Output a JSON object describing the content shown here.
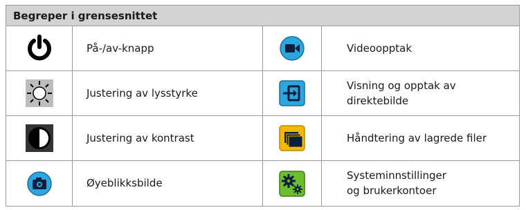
{
  "table": {
    "title": "Begreper i grensesnittet",
    "left": [
      {
        "icon": "power-icon",
        "label": "På-/av-knapp"
      },
      {
        "icon": "brightness-icon",
        "label": "Justering av lysstyrke"
      },
      {
        "icon": "contrast-icon",
        "label": "Justering av kontrast"
      },
      {
        "icon": "camera-icon",
        "label": "Øyeblikksbilde"
      }
    ],
    "right": [
      {
        "icon": "video-camera-icon",
        "label": "Videoopptak"
      },
      {
        "icon": "live-view-icon",
        "label_line1": "Visning og opptak av",
        "label_line2": "direktebilde"
      },
      {
        "icon": "folders-icon",
        "label": "Håndtering av lagrede filer"
      },
      {
        "icon": "gears-icon",
        "label_line1": "Systeminnstillinger",
        "label_line2": "og brukerkontoer"
      }
    ]
  },
  "colors": {
    "header_bg": "#d3d3d3",
    "blue": "#2aa7de",
    "yellow": "#f5b800",
    "green": "#6dbe2c"
  }
}
